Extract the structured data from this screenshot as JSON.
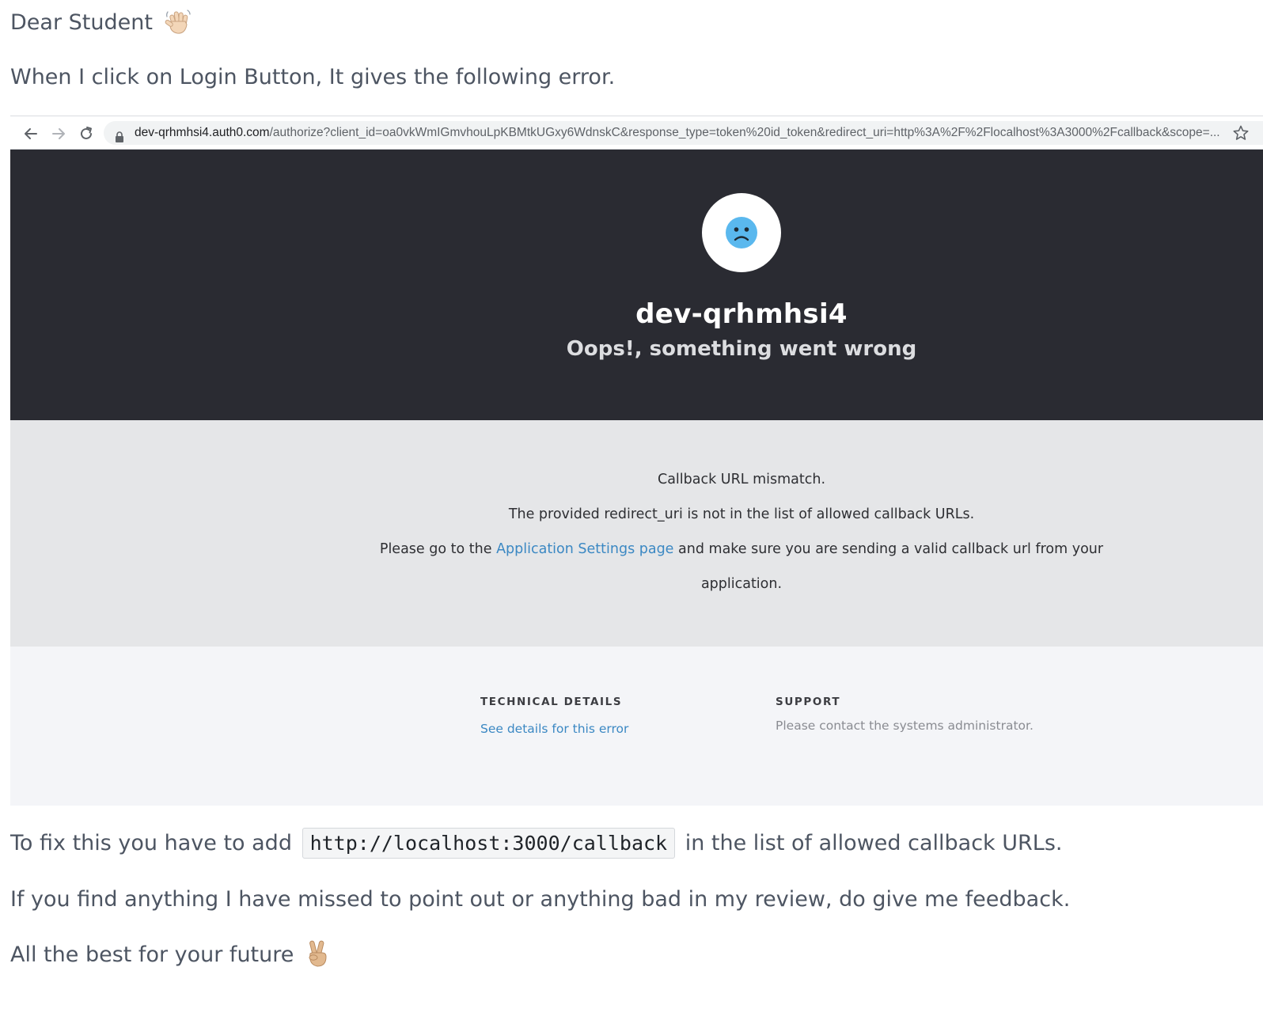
{
  "greeting": {
    "text": "Dear Student",
    "emoji": "waving-hand-icon"
  },
  "intro": "When I click on Login Button, It gives the following error.",
  "screenshot": {
    "browser": {
      "url_domain": "dev-qrhmhsi4.auth0.com",
      "url_path": "/authorize?client_id=oa0vkWmIGmvhouLpKBMtkUGxy6WdnskC&response_type=token%20id_token&redirect_uri=http%3A%2F%2Flocalhost%3A3000%2Fcallback&scope=...",
      "icons": [
        "back-arrow-icon",
        "forward-arrow-icon",
        "reload-icon",
        "lock-icon",
        "star-icon"
      ]
    },
    "error_header": {
      "tenant": "dev-qrhmhsi4",
      "message": "Oops!, something went wrong",
      "icon": "sad-face-icon"
    },
    "error_body": {
      "line1": "Callback URL mismatch.",
      "line2": "The provided redirect_uri is not in the list of allowed callback URLs.",
      "line3_before": "Please go to the",
      "line3_link": "Application Settings page",
      "line3_after": "and make sure you are sending a valid callback url from your",
      "line4": "application."
    },
    "footer": {
      "technical_title": "TECHNICAL DETAILS",
      "technical_link": "See details for this error",
      "support_title": "SUPPORT",
      "support_text": "Please contact the systems administrator."
    }
  },
  "fix": {
    "before": "To fix this you have to add",
    "code": "http://localhost:3000/callback",
    "after": "in the list of allowed callback URLs."
  },
  "feedback": "If you find anything I have missed to point out or anything bad in my review, do give me feedback.",
  "closing": {
    "text": "All the best for your future",
    "emoji": "victory-hand-icon"
  },
  "colors": {
    "error_header_bg": "#2a2b32",
    "error_body_bg": "#e5e6e8",
    "footer_bg": "#f4f5f8",
    "link": "#3b88c3",
    "sad_face": "#5ab8ee"
  }
}
